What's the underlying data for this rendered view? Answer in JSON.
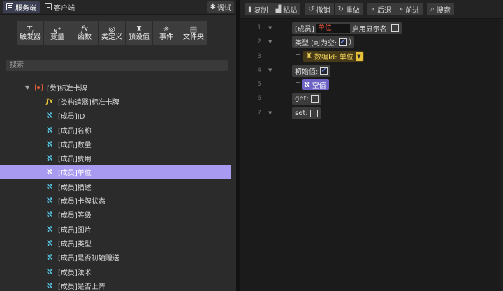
{
  "left_panel": {
    "tabs": [
      {
        "label": "服务端",
        "icon": "server-icon",
        "active": true
      },
      {
        "label": "客户端",
        "icon": "client-icon",
        "active": false
      }
    ],
    "debug_label": "调试",
    "tools": [
      {
        "glyph": "T",
        "label": "触发器",
        "icon": "trigger-icon"
      },
      {
        "glyph": "x",
        "label": "变量",
        "icon": "variable-icon"
      },
      {
        "glyph": "fx",
        "label": "函数",
        "icon": "function-icon"
      },
      {
        "glyph": "◎",
        "label": "类定义",
        "icon": "class-icon"
      },
      {
        "glyph": "♜",
        "label": "预设值",
        "icon": "preset-icon"
      },
      {
        "glyph": "✳",
        "label": "事件",
        "icon": "event-icon"
      },
      {
        "glyph": "▤",
        "label": "文件夹",
        "icon": "folder-icon"
      }
    ],
    "search_placeholder": "搜索",
    "tree": {
      "root_label": "[类]标准卡牌",
      "items": [
        {
          "label": "[类构造器]标准卡牌",
          "kind": "fx"
        },
        {
          "label": "[成员]ID",
          "kind": "member"
        },
        {
          "label": "[成员]名称",
          "kind": "member"
        },
        {
          "label": "[成员]数量",
          "kind": "member"
        },
        {
          "label": "[成员]费用",
          "kind": "member"
        },
        {
          "label": "[成员]单位",
          "kind": "member",
          "selected": true
        },
        {
          "label": "[成员]描述",
          "kind": "member"
        },
        {
          "label": "[成员]卡牌状态",
          "kind": "member"
        },
        {
          "label": "[成员]等级",
          "kind": "member"
        },
        {
          "label": "[成员]图片",
          "kind": "member"
        },
        {
          "label": "[成员]类型",
          "kind": "member"
        },
        {
          "label": "[成员]是否初始赠送",
          "kind": "member"
        },
        {
          "label": "[成员]法术",
          "kind": "member"
        },
        {
          "label": "[成员]是否上阵",
          "kind": "member"
        }
      ]
    }
  },
  "right_panel": {
    "toolbar": {
      "copy": "复制",
      "paste": "粘贴",
      "undo": "撤销",
      "redo": "重做",
      "back": "后退",
      "forward": "前进",
      "search": "搜索"
    },
    "lines": {
      "n1": "1",
      "n2": "2",
      "n3": "3",
      "n4": "4",
      "n5": "5",
      "n6": "6",
      "n7": "7",
      "member_prefix": "[成员]",
      "member_name": "单位",
      "enable_display_name": "启用显示名:",
      "type_label": "类型",
      "nullable_label": "(可为空:",
      "type_value": "数编Id: 单位",
      "initial_value_label": "初始值:",
      "null_value": "空值",
      "get_label": "get:",
      "set_label": "set:"
    },
    "colors": {
      "selected_row": "#a89af0",
      "member_name_text": "#ff5a3a",
      "type_block": "#e8c23a",
      "null_block": "#6e63c4"
    }
  }
}
